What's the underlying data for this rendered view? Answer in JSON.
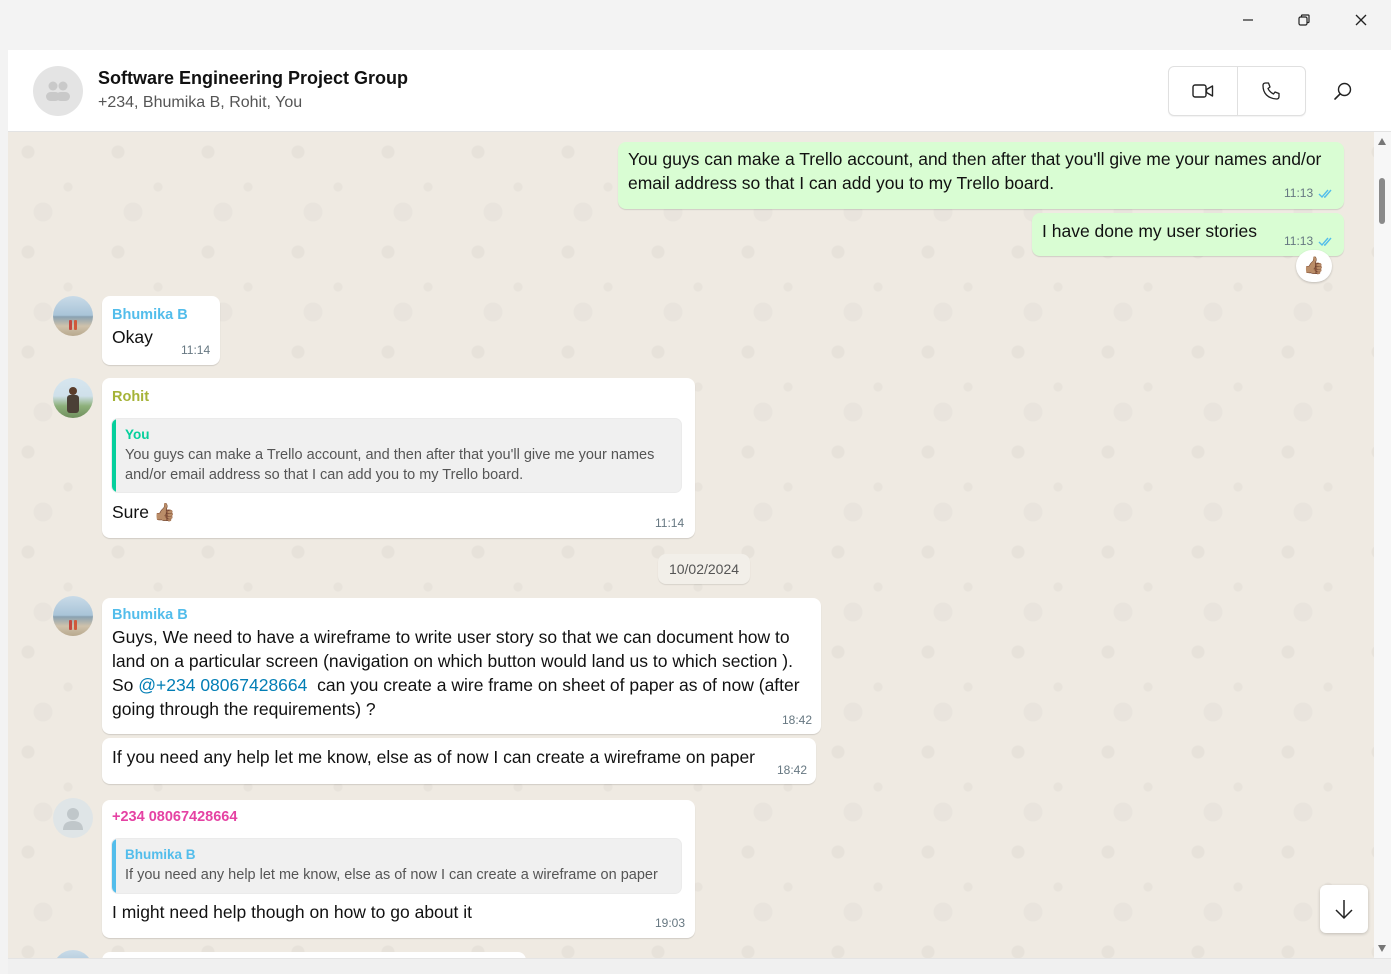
{
  "window": {
    "controls": [
      "minimize-icon",
      "restore-icon",
      "close-icon"
    ]
  },
  "header": {
    "title": "Software Engineering Project Group",
    "participants": "+234, Bhumika B, Rohit, You",
    "icons": [
      "group-avatar-icon",
      "video-call-icon",
      "voice-call-icon",
      "search-icon"
    ]
  },
  "colors": {
    "outgoing_bubble": "#d9fdd3",
    "incoming_bubble": "#ffffff",
    "chat_background": "#efeae2",
    "bhumika_name": "#53bdeb",
    "rohit_name": "#a5b337",
    "unknown_name": "#e542a3",
    "you_name": "#06cf9c",
    "read_ticks": "#53bdeb"
  },
  "messages": [
    {
      "sender": "You",
      "text": "You guys can make a Trello account, and then after that you'll give me your names and/or email address so that I can add you to my Trello board.",
      "time": "11:13",
      "status": "read-ticks-icon"
    },
    {
      "sender": "You",
      "text": "I have done my user stories",
      "time": "11:13",
      "status": "read-ticks-icon",
      "reaction": "👍🏽"
    },
    {
      "sender": "Bhumika B",
      "text": "Okay",
      "time": "11:14"
    },
    {
      "sender": "Rohit",
      "quote": {
        "name": "You",
        "text": "You guys can make a Trello account, and then after that you'll give me your names and/or email address so that I can add you to my Trello board."
      },
      "text": "Sure 👍🏽",
      "time": "11:14"
    },
    {
      "date_divider": "10/02/2024"
    },
    {
      "sender": "Bhumika B",
      "text_lines": [
        "Guys, We need to have a wireframe to write user story so that we can document how to",
        "land on a particular screen (navigation on which button would land us to which section )."
      ],
      "text_before_mention": "So ",
      "mention": "@+234 08067428664",
      "text_after_mention": "  can you create a wire frame on sheet of paper as of now (after",
      "text_end": "going through the requirements) ?",
      "time": "18:42"
    },
    {
      "sender": "Bhumika B",
      "text": "If you need any help let me know, else as of now I can create a wireframe on paper",
      "time": "18:42"
    },
    {
      "sender": "+234 08067428664",
      "quote": {
        "name": "Bhumika B",
        "text": "If you need any help let me know, else as of now I can create a wireframe on paper"
      },
      "text": "I might need help though on how to go about it",
      "time": "19:03"
    }
  ]
}
